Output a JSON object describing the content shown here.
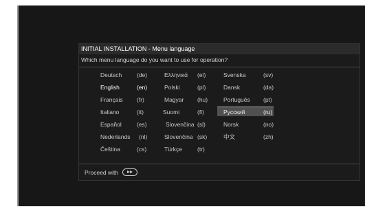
{
  "title": "INITIAL INSTALLATION - Menu language",
  "question": "Which menu language do you want to use for operation?",
  "footer": {
    "label": "Proceed with",
    "icon": "ok-button-icon"
  },
  "languages": [
    {
      "name": "Deutsch",
      "code": "(de)"
    },
    {
      "name": "English",
      "code": "(en)"
    },
    {
      "name": "Français",
      "code": "(fr)"
    },
    {
      "name": "Italiano",
      "code": "(it)"
    },
    {
      "name": "Español",
      "code": "(es)"
    },
    {
      "name": "Nederlands",
      "code": "(nl)"
    },
    {
      "name": "Čeština",
      "code": "(cs)"
    },
    {
      "name": "Ελληνικά",
      "code": "(el)"
    },
    {
      "name": "Polski",
      "code": "(pl)"
    },
    {
      "name": "Magyar",
      "code": "(hu)"
    },
    {
      "name": "Suomi",
      "code": "(fi)"
    },
    {
      "name": "Slovenčina",
      "code": "(sl)"
    },
    {
      "name": "Slovenčina",
      "code": "(sk)"
    },
    {
      "name": "Türkçe",
      "code": "(tr)"
    },
    {
      "name": "Svenska",
      "code": "(sv)"
    },
    {
      "name": "Dansk",
      "code": "(da)"
    },
    {
      "name": "Português",
      "code": "(pt)"
    },
    {
      "name": "Русский",
      "code": "(ru)"
    },
    {
      "name": "Norsk",
      "code": "(no)"
    },
    {
      "name": "中文",
      "code": "(zh)"
    }
  ],
  "current_language": "English",
  "highlighted_language": "Русский"
}
